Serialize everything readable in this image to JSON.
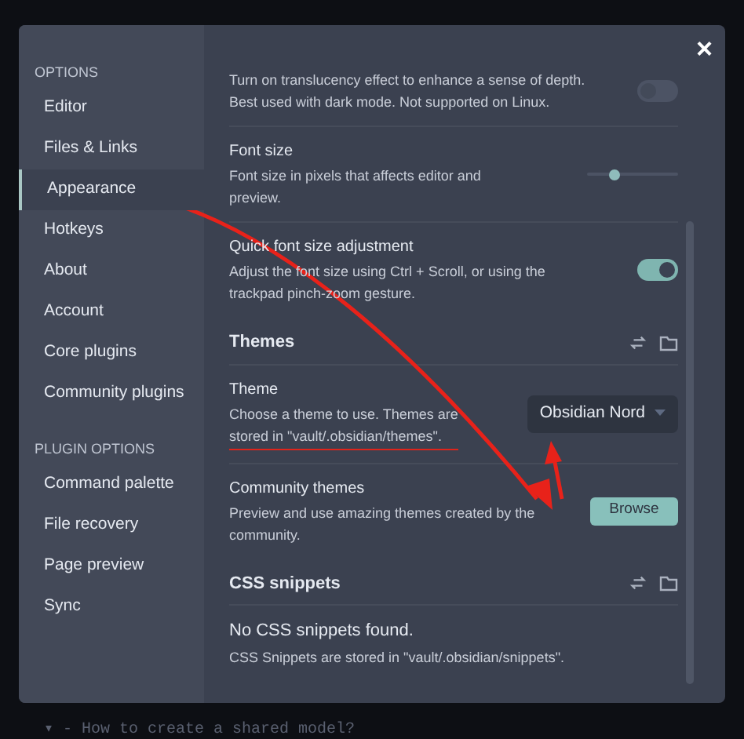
{
  "sidebar": {
    "sections": [
      {
        "heading": "OPTIONS",
        "items": [
          {
            "label": "Editor",
            "selected": false
          },
          {
            "label": "Files & Links",
            "selected": false
          },
          {
            "label": "Appearance",
            "selected": true
          },
          {
            "label": "Hotkeys",
            "selected": false
          },
          {
            "label": "About",
            "selected": false
          },
          {
            "label": "Account",
            "selected": false
          },
          {
            "label": "Core plugins",
            "selected": false
          },
          {
            "label": "Community plugins",
            "selected": false
          }
        ]
      },
      {
        "heading": "PLUGIN OPTIONS",
        "items": [
          {
            "label": "Command palette",
            "selected": false
          },
          {
            "label": "File recovery",
            "selected": false
          },
          {
            "label": "Page preview",
            "selected": false
          },
          {
            "label": "Sync",
            "selected": false
          }
        ]
      }
    ]
  },
  "close": "×",
  "settings": [
    {
      "kind": "toggle",
      "description": [
        "Turn on translucency effect to enhance a sense of depth.",
        "Best used with dark mode. Not supported on Linux."
      ],
      "on": false
    },
    {
      "kind": "slider",
      "title": "Font size",
      "description": [
        "Font size in pixels that affects editor and",
        "preview."
      ],
      "level": 0.3
    },
    {
      "kind": "toggle",
      "title": "Quick font size adjustment",
      "description": [
        "Adjust the font size using Ctrl + Scroll, or using the",
        "trackpad pinch-zoom gesture."
      ],
      "on": true
    },
    {
      "kind": "heading",
      "title": "Themes"
    },
    {
      "kind": "dropdown",
      "title": "Theme",
      "description": [
        "Choose a theme to use. Themes are",
        "stored in \"vault/.obsidian/themes\"."
      ],
      "value": "Obsidian Nord"
    },
    {
      "kind": "button",
      "title": "Community themes",
      "description": [
        "Preview and use amazing themes created by the",
        "community."
      ],
      "button": "Browse"
    },
    {
      "kind": "heading",
      "title": "CSS snippets"
    },
    {
      "kind": "note",
      "title": "No CSS snippets found.",
      "description": [
        "CSS Snippets are stored in \"vault/.obsidian/snippets\"."
      ]
    }
  ],
  "background_line": {
    "marker": "▾",
    "text": "- How to create a shared model?"
  }
}
